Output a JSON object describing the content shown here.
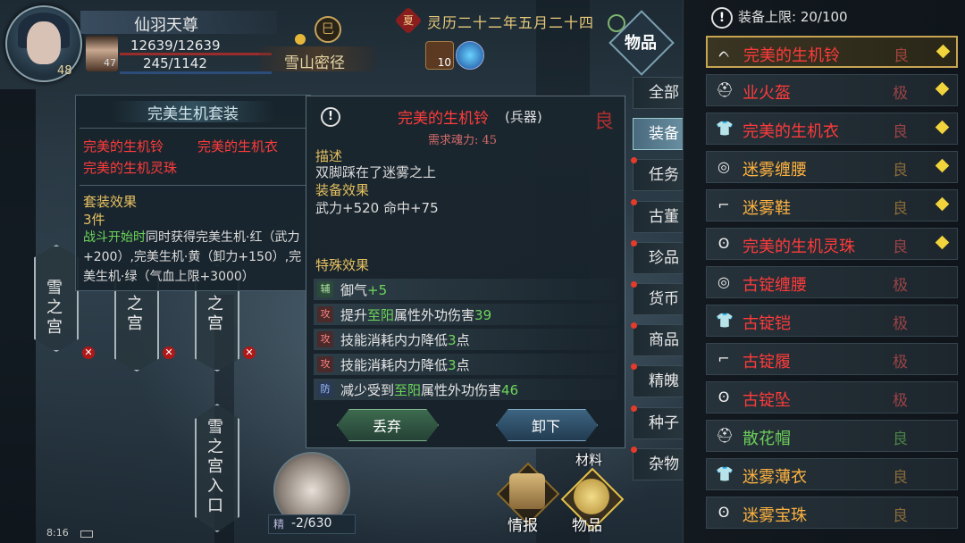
{
  "player": {
    "name": "仙羽天尊",
    "level": "48",
    "hp": "12639/12639",
    "mp": "245/1142",
    "companion_level": "47"
  },
  "location": {
    "name": "雪山密径",
    "badge": "巳"
  },
  "date": {
    "icon_char": "夏",
    "text": "灵历二十二年五月二十四"
  },
  "buff_count": "10",
  "inventory": {
    "title": "物品",
    "capacity_label": "装备上限: 20/100",
    "categories": [
      {
        "label": "全部",
        "active": false,
        "dot": false
      },
      {
        "label": "装备",
        "active": true,
        "dot": false
      },
      {
        "label": "任务",
        "active": false,
        "dot": true
      },
      {
        "label": "古董",
        "active": false,
        "dot": true
      },
      {
        "label": "珍品",
        "active": false,
        "dot": true
      },
      {
        "label": "货币",
        "active": false,
        "dot": true
      },
      {
        "label": "商品",
        "active": false,
        "dot": true
      },
      {
        "label": "精魄",
        "active": false,
        "dot": true
      },
      {
        "label": "种子",
        "active": false,
        "dot": true
      },
      {
        "label": "杂物",
        "active": false,
        "dot": true
      }
    ],
    "items": [
      {
        "name": "完美的生机铃",
        "grade": "良",
        "color": "#ff3b3b",
        "grade_color": "#ff5a5a",
        "icon": "bell-icon",
        "glyph": "ᨈ",
        "equipped": true,
        "selected": true
      },
      {
        "name": "业火盔",
        "grade": "极",
        "color": "#ff3b3b",
        "grade_color": "#ff5a5a",
        "icon": "helmet-icon",
        "glyph": "⛑",
        "equipped": true,
        "selected": false
      },
      {
        "name": "完美的生机衣",
        "grade": "良",
        "color": "#ff3b3b",
        "grade_color": "#ff5a5a",
        "icon": "robe-icon",
        "glyph": "👕",
        "equipped": true,
        "selected": false
      },
      {
        "name": "迷雾缠腰",
        "grade": "良",
        "color": "#ffb340",
        "grade_color": "#e0a040",
        "icon": "belt-icon",
        "glyph": "◎",
        "equipped": true,
        "selected": false
      },
      {
        "name": "迷雾鞋",
        "grade": "良",
        "color": "#ffb340",
        "grade_color": "#e0a040",
        "icon": "shoes-icon",
        "glyph": "⌐",
        "equipped": true,
        "selected": false
      },
      {
        "name": "完美的生机灵珠",
        "grade": "良",
        "color": "#ff3b3b",
        "grade_color": "#ff5a5a",
        "icon": "pendant-icon",
        "glyph": "ʘ",
        "equipped": true,
        "selected": false
      },
      {
        "name": "古锭缠腰",
        "grade": "极",
        "color": "#ff3b3b",
        "grade_color": "#ff5a5a",
        "icon": "belt-icon",
        "glyph": "◎",
        "equipped": false,
        "selected": false
      },
      {
        "name": "古锭铠",
        "grade": "极",
        "color": "#ff3b3b",
        "grade_color": "#ff5a5a",
        "icon": "armor-icon",
        "glyph": "👕",
        "equipped": false,
        "selected": false
      },
      {
        "name": "古锭履",
        "grade": "极",
        "color": "#ff3b3b",
        "grade_color": "#ff5a5a",
        "icon": "shoes-icon",
        "glyph": "⌐",
        "equipped": false,
        "selected": false
      },
      {
        "name": "古锭坠",
        "grade": "极",
        "color": "#ff3b3b",
        "grade_color": "#ff5a5a",
        "icon": "pendant-icon",
        "glyph": "ʘ",
        "equipped": false,
        "selected": false
      },
      {
        "name": "散花帽",
        "grade": "良",
        "color": "#6dce5a",
        "grade_color": "#6dce5a",
        "icon": "helmet-icon",
        "glyph": "⛑",
        "equipped": false,
        "selected": false
      },
      {
        "name": "迷雾薄衣",
        "grade": "良",
        "color": "#ffb340",
        "grade_color": "#e0a040",
        "icon": "robe-icon",
        "glyph": "👕",
        "equipped": false,
        "selected": false
      },
      {
        "name": "迷雾宝珠",
        "grade": "良",
        "color": "#ffb340",
        "grade_color": "#e0a040",
        "icon": "pendant-icon",
        "glyph": "ʘ",
        "equipped": false,
        "selected": false
      }
    ]
  },
  "set_panel": {
    "title": "完美生机套装",
    "pieces": [
      "完美的生机铃",
      "完美的生机衣",
      "完美的生机灵珠"
    ],
    "effect_label": "套装效果",
    "count_label": "3件",
    "effect_trigger": "战斗开始时",
    "effect_text": "同时获得完美生机·红（武力+200）,完美生机·黄（卸力+150）,完美生机·绿（气血上限+3000）"
  },
  "item_detail": {
    "name": "完美的生机铃",
    "type": "(兵器)",
    "grade": "良",
    "requirement": "需求魂力: 45",
    "desc_label": "描述",
    "desc_text": "双脚踩在了迷雾之上",
    "equip_label": "装备效果",
    "equip_text": "武力+520 命中+75",
    "special_label": "特殊效果",
    "special": [
      {
        "tag": "辅",
        "tag_class": "tg-green",
        "pre": "御气",
        "hl": "+5",
        "post": ""
      },
      {
        "tag": "攻",
        "tag_class": "tg-red",
        "pre": "提升",
        "hl": "至阳",
        "post": "属性外功伤害",
        "num": "39"
      },
      {
        "tag": "攻",
        "tag_class": "tg-red",
        "pre": "技能消耗内力降低",
        "hl": "",
        "post": "点",
        "num": "3"
      },
      {
        "tag": "攻",
        "tag_class": "tg-red",
        "pre": "技能消耗内力降低",
        "hl": "",
        "post": "点",
        "num": "3"
      },
      {
        "tag": "防",
        "tag_class": "tg-blue",
        "pre": "减少受到",
        "hl": "至阳",
        "post": "属性外功伤害",
        "num": "46"
      }
    ],
    "discard_label": "丢弃",
    "unequip_label": "卸下"
  },
  "map_nodes": [
    {
      "label": "雪之宫"
    },
    {
      "label": "之宫"
    },
    {
      "label": "之宫"
    },
    {
      "label": "雪之宫入口"
    }
  ],
  "pet": {
    "label": "精",
    "value": "-2/630"
  },
  "bottom": {
    "info_label": "情报",
    "items_label": "物品",
    "materials_label": "材料"
  },
  "status_time": "8:16"
}
